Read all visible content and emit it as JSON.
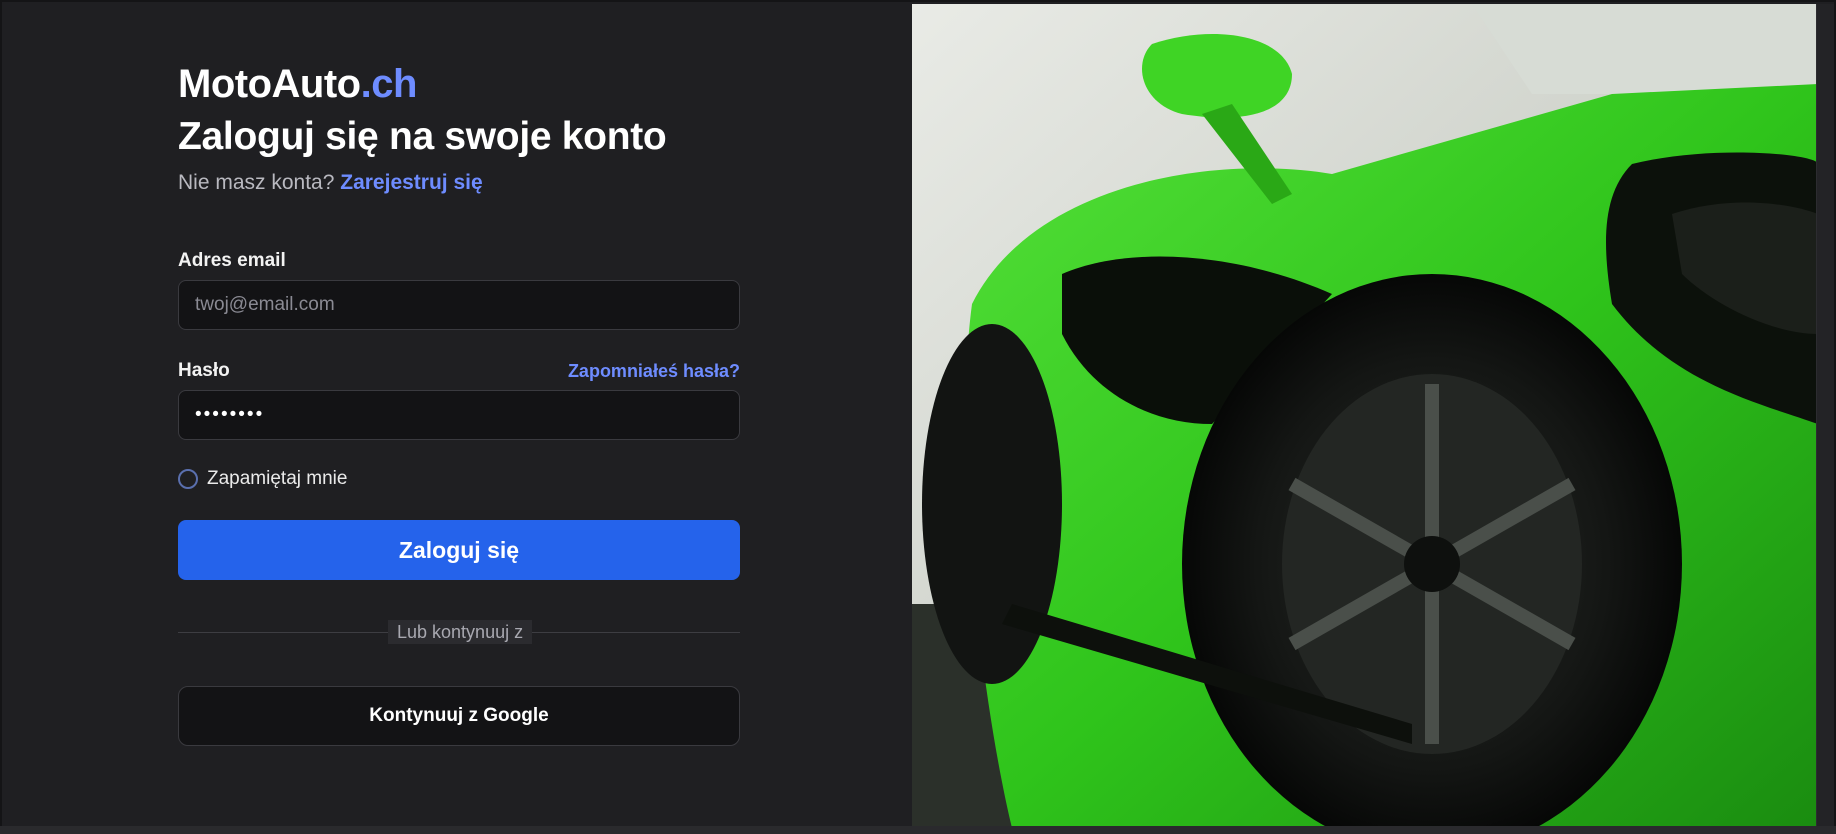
{
  "brand": {
    "name": "MotoAuto",
    "tld": ".ch"
  },
  "login": {
    "title": "Zaloguj się na swoje konto",
    "no_account_text": "Nie masz konta?",
    "register_link": "Zarejestruj się",
    "email_label": "Adres email",
    "email_placeholder": "twoj@email.com",
    "password_label": "Hasło",
    "forgot_link": "Zapomniałeś hasła?",
    "password_value": "••••••••",
    "remember_label": "Zapamiętaj mnie",
    "submit_label": "Zaloguj się",
    "divider_text": "Lub kontynuuj z",
    "google_label": "Kontynuuj z Google"
  },
  "hero_image": {
    "subject": "green sports car",
    "accent_color": "#2fc41b"
  },
  "colors": {
    "accent": "#6e8cff",
    "primary_button": "#2563eb",
    "background": "#1f1f22"
  }
}
